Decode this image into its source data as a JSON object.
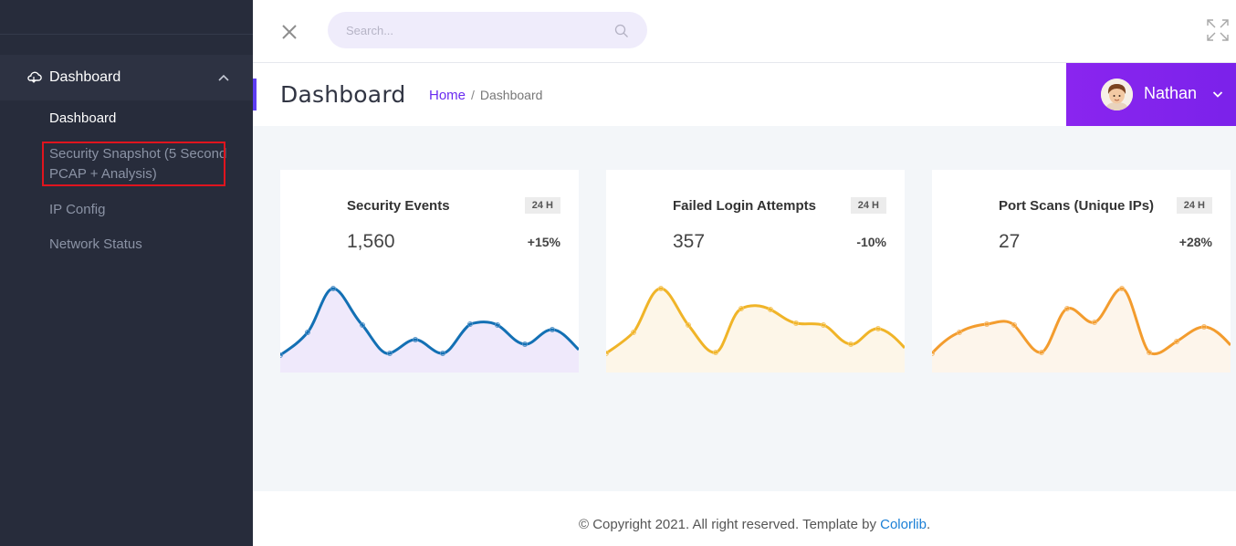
{
  "sidebar": {
    "section_label": "Dashboard",
    "items": [
      {
        "label": "Dashboard"
      },
      {
        "label": "Security Snapshot (5 Second PCAP + Analysis)"
      },
      {
        "label": "IP Config"
      },
      {
        "label": "Network Status"
      }
    ]
  },
  "topbar": {
    "search_placeholder": "Search..."
  },
  "header": {
    "title": "Dashboard",
    "breadcrumb_home": "Home",
    "breadcrumb_sep": "/",
    "breadcrumb_current": "Dashboard",
    "user_name": "Nathan"
  },
  "cards": [
    {
      "title": "Security Events",
      "badge": "24 H",
      "value": "1,560",
      "change": "+15%",
      "line_color": "#1370b4",
      "fill_color": "#efe9fb"
    },
    {
      "title": "Failed Login Attempts",
      "badge": "24 H",
      "value": "357",
      "change": "-10%",
      "line_color": "#f0b428",
      "fill_color": "#fdf6e8"
    },
    {
      "title": "Port Scans (Unique IPs)",
      "badge": "24 H",
      "value": "27",
      "change": "+28%",
      "line_color": "#f39c2e",
      "fill_color": "#fdf5eb"
    }
  ],
  "footer": {
    "text": "© Copyright 2021. All right reserved. Template by ",
    "link": "Colorlib",
    "suffix": "."
  },
  "colors": {
    "sidebar_bg": "#272c3b",
    "accent_purple": "#7b22ea",
    "highlight_red": "#e0141e"
  }
}
